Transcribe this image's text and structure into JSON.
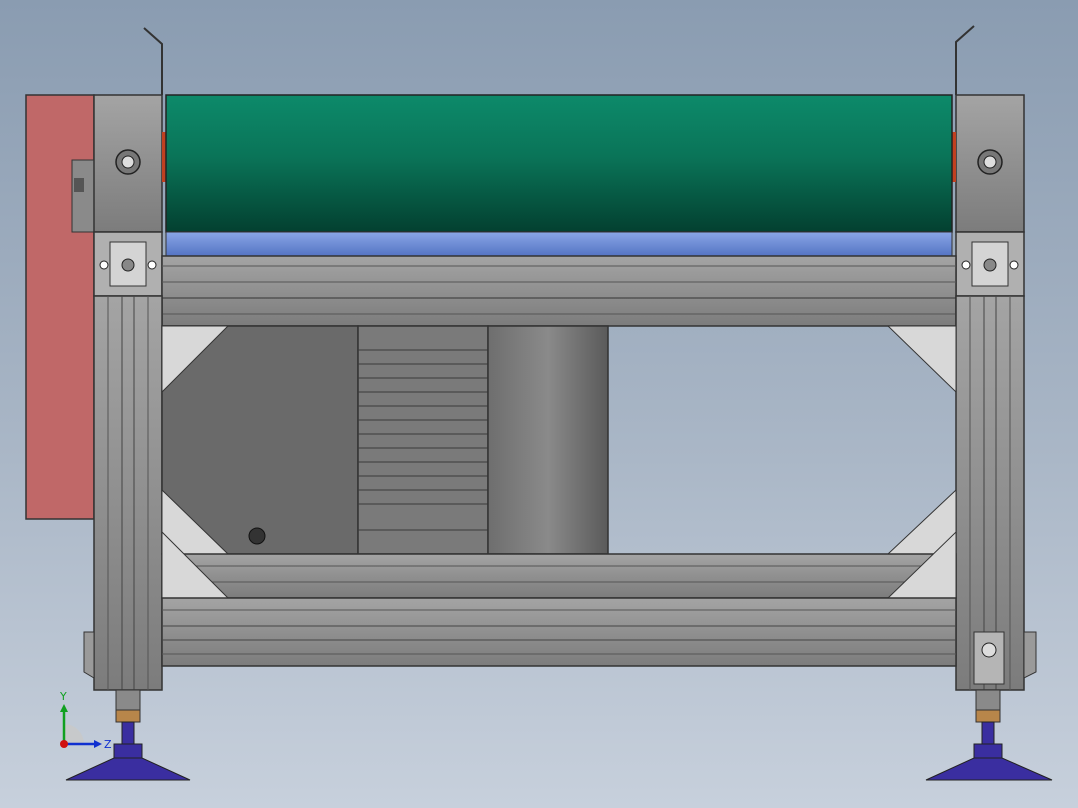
{
  "triad": {
    "y_label": "Y",
    "z_label": "Z",
    "x_color": "#d01010",
    "y_color": "#10a020",
    "z_color": "#1030d0"
  },
  "colors": {
    "roller": "#0a7a5c",
    "roller_dark": "#044a36",
    "belt_edge": "#6f8fd8",
    "frame": "#8c8c8c",
    "frame_dark": "#3a3a3a",
    "panel": "#c06868",
    "feet": "#3a2ea0",
    "nut": "#b8864a"
  }
}
